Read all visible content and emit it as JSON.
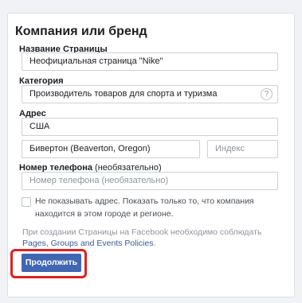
{
  "form": {
    "title": "Компания или бренд",
    "page_name": {
      "label": "Название Страницы",
      "value": "Неофициальная страница \"Nike\""
    },
    "category": {
      "label": "Категория",
      "value": "Производитель товаров для спорта и туризма",
      "help_icon": "question-circle-icon"
    },
    "address": {
      "label": "Адрес",
      "country": "США",
      "city": "Бивертон (Beaverton, Oregon)",
      "zip_placeholder": "Индекс"
    },
    "phone": {
      "label": "Номер телефона",
      "label_optional": " (необязательно)",
      "placeholder": "Номер телефона (необязательно)"
    },
    "hide_address": {
      "checked": false,
      "text": "Не показывать адрес. Показать только то, что компания находится в этом городе и регионе."
    },
    "policy": {
      "text": "При создании Страницы на Facebook необходимо соблюдать ",
      "link1": "Pages, Groups and Events Policies",
      "suffix": "."
    },
    "submit_label": "Продолжить"
  },
  "colors": {
    "accent": "#4267b2",
    "highlight": "#e02020",
    "link": "#385898"
  }
}
